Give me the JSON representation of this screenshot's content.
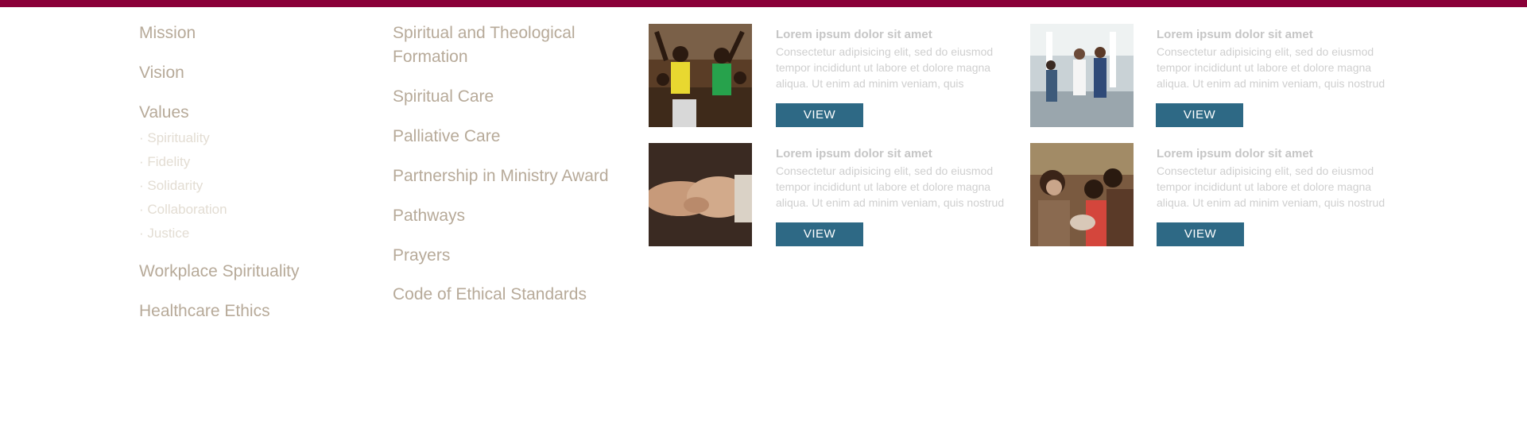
{
  "brand": {
    "accent": "#8a0038",
    "button": "#2e6985"
  },
  "menu_left": {
    "items": [
      {
        "label": "Mission"
      },
      {
        "label": "Vision"
      },
      {
        "label": "Values"
      },
      {
        "label": "Workplace Spirituality"
      },
      {
        "label": "Healthcare Ethics"
      }
    ],
    "values_subitems": [
      {
        "label": "· Spirituality"
      },
      {
        "label": "· Fidelity"
      },
      {
        "label": "· Solidarity"
      },
      {
        "label": "· Collaboration"
      },
      {
        "label": "· Justice"
      }
    ]
  },
  "menu_mid": {
    "items": [
      {
        "label": "Spiritual and Theological Formation"
      },
      {
        "label": "Spiritual Care"
      },
      {
        "label": "Palliative Care"
      },
      {
        "label": "Partnership in Ministry Award"
      },
      {
        "label": "Pathways"
      },
      {
        "label": "Prayers"
      },
      {
        "label": "Code of Ethical Standards"
      }
    ]
  },
  "cards": [
    {
      "image": "children-celebrating-photo",
      "title": "Lorem ipsum dolor sit amet",
      "description": "Consectetur adipisicing elit, sed do eiusmod tempor incididunt ut labore et dolore magna aliqua. Ut enim ad minim veniam, quis",
      "button": "VIEW"
    },
    {
      "image": "hospital-staff-photo",
      "title": "Lorem ipsum dolor sit amet",
      "description": "Consectetur adipisicing elit, sed do eiusmod tempor incididunt ut labore et dolore magna aliqua. Ut enim ad minim veniam, quis nostrud",
      "button": "VIEW"
    },
    {
      "image": "holding-hands-photo",
      "title": "Lorem ipsum dolor sit amet",
      "description": "Consectetur adipisicing elit, sed do eiusmod tempor incididunt ut labore et dolore magna aliqua. Ut enim ad minim veniam, quis nostrud",
      "button": "VIEW"
    },
    {
      "image": "community-group-photo",
      "title": "Lorem ipsum dolor sit amet",
      "description": "Consectetur adipisicing elit, sed do eiusmod tempor incididunt ut labore et dolore magna aliqua. Ut enim ad minim veniam, quis nostrud",
      "button": "VIEW"
    }
  ]
}
